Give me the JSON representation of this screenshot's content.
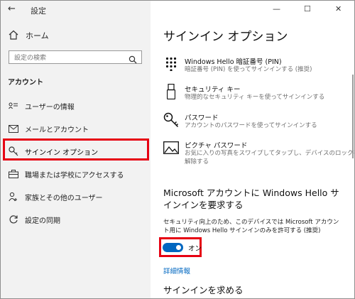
{
  "window": {
    "title": "設定",
    "controls": {
      "minimize": "—",
      "maximize": "☐",
      "close": "✕"
    }
  },
  "sidebar": {
    "home": "ホーム",
    "search_placeholder": "設定の検索",
    "section_title": "アカウント",
    "items": [
      {
        "label": "ユーザーの情報",
        "icon": "user-info-icon"
      },
      {
        "label": "メールとアカウント",
        "icon": "mail-icon"
      },
      {
        "label": "サインイン オプション",
        "icon": "key-icon",
        "active": true
      },
      {
        "label": "職場または学校にアクセスする",
        "icon": "briefcase-icon"
      },
      {
        "label": "家族とその他のユーザー",
        "icon": "people-icon"
      },
      {
        "label": "設定の同期",
        "icon": "sync-icon"
      }
    ]
  },
  "main": {
    "title": "サインイン オプション",
    "options": [
      {
        "title": "Windows Hello 暗証番号 (PIN)",
        "desc": "暗証番号 (PIN) を使ってサインインする (推奨)",
        "icon": "pin-pad-icon"
      },
      {
        "title": "セキュリティ キー",
        "desc": "物理的なセキュリティ キーを使ってサインインする",
        "icon": "usb-key-icon"
      },
      {
        "title": "パスワード",
        "desc": "アカウントのパスワードを使ってサインインする",
        "icon": "key-icon"
      },
      {
        "title": "ピクチャ パスワード",
        "desc": "お気に入りの写真をスワイプしてタップし、デバイスのロックを解除する",
        "desc2": "",
        "icon": "picture-icon"
      }
    ],
    "hello_title": "Microsoft アカウントに Windows Hello サインインを要求する",
    "hello_desc": "セキュリティ向上のため、このデバイスでは Microsoft アカウント用に Windows Hello サインインのみを許可する (推奨)",
    "toggle_label": "オン",
    "toggle_on": true,
    "link": "詳細情報",
    "next_section": "サインインを求める"
  },
  "colors": {
    "accent": "#0067c0",
    "highlight": "#e60012",
    "sidebar_bg": "#f2f2f2"
  }
}
